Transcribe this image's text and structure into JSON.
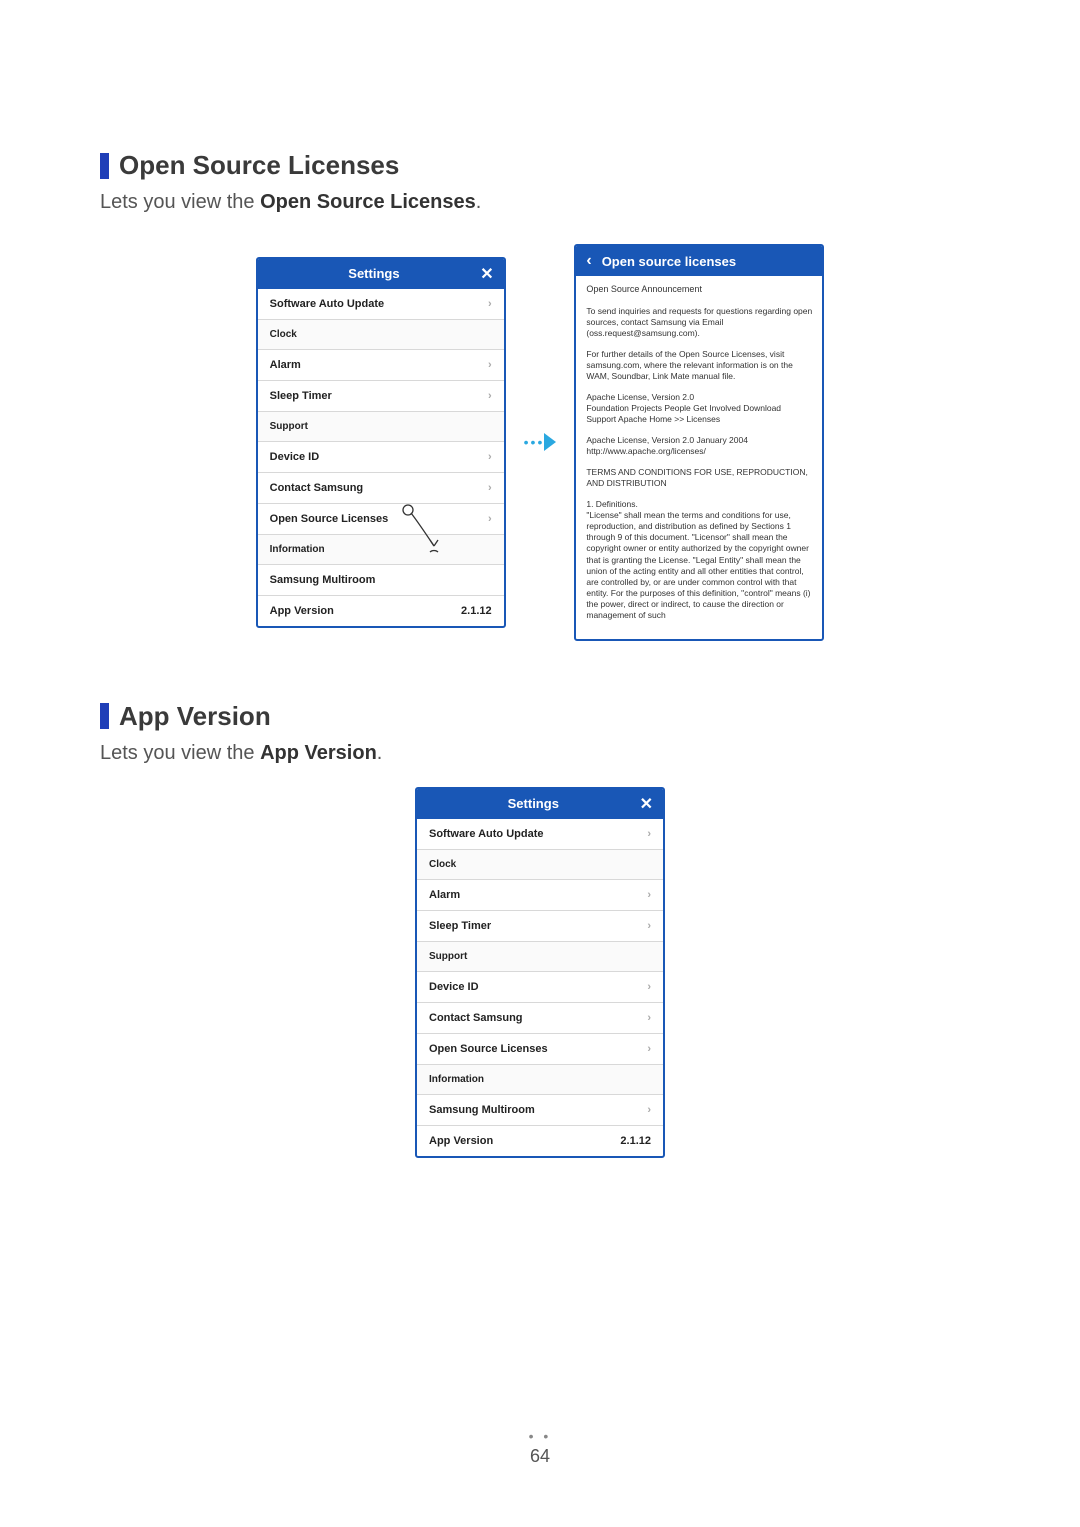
{
  "section1": {
    "title": "Open Source Licenses",
    "desc_prefix": "Lets you view the ",
    "desc_bold": "Open Source Licenses",
    "desc_suffix": "."
  },
  "section2": {
    "title": "App Version",
    "desc_prefix": "Lets you view the ",
    "desc_bold": "App Version",
    "desc_suffix": "."
  },
  "settings_panel": {
    "header": "Settings",
    "close_label": "✕",
    "items": {
      "software_auto_update": "Software Auto Update",
      "clock": "Clock",
      "alarm": "Alarm",
      "sleep_timer": "Sleep Timer",
      "support": "Support",
      "device_id": "Device ID",
      "contact_samsung": "Contact Samsung",
      "open_source_licenses": "Open Source Licenses",
      "information": "Information",
      "samsung_multiroom": "Samsung Multiroom",
      "app_version": "App Version",
      "app_version_value": "2.1.12"
    }
  },
  "osl_panel": {
    "header": "Open source licenses",
    "back_label": "‹",
    "announcement": "Open Source Announcement",
    "p1": "To send inquiries and requests for questions regarding open sources, contact Samsung via Email (oss.request@samsung.com).",
    "p2": "For further details of the Open Source Licenses, visit samsung.com, where the relevant information is on the WAM, Soundbar, Link Mate manual file.",
    "p3": "Apache License, Version 2.0\nFoundation Projects People Get Involved Download Support Apache Home >> Licenses",
    "p4": "Apache License, Version 2.0 January 2004\nhttp://www.apache.org/licenses/",
    "p5": "TERMS AND CONDITIONS FOR USE, REPRODUCTION, AND DISTRIBUTION",
    "p6": "1. Definitions.\n\"License\" shall mean the terms and conditions for use, reproduction, and distribution as defined by Sections 1 through 9 of this document. \"Licensor\" shall mean the copyright owner or entity authorized by the copyright owner that is granting the License. \"Legal Entity\" shall mean the union of the acting entity and all other entities that control, are controlled by, or are under common control with that entity. For the purposes of this definition, \"control\" means (i) the power, direct or indirect, to cause the direction or management of such"
  },
  "page_number": "64"
}
